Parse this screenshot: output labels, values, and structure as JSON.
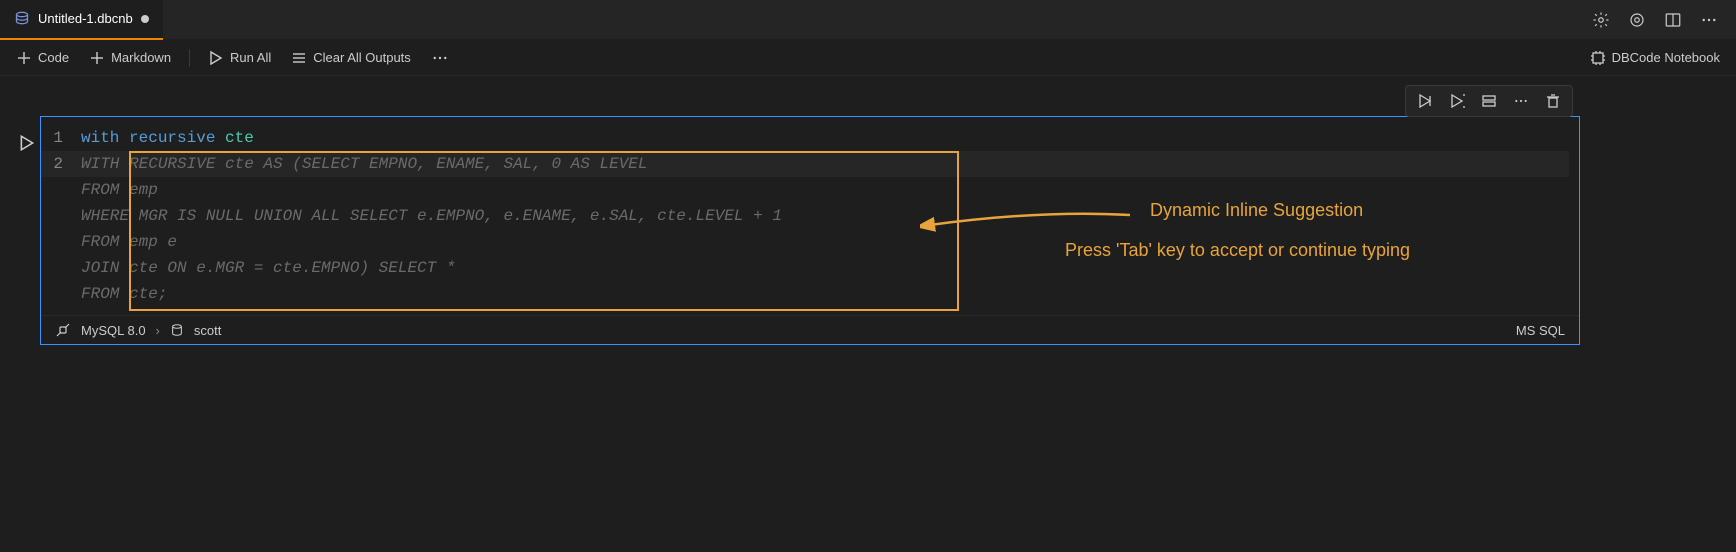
{
  "tab": {
    "title": "Untitled-1.dbcnb",
    "icon": "database-stack-icon"
  },
  "toolbar": {
    "code": "Code",
    "markdown": "Markdown",
    "run_all": "Run All",
    "clear_outputs": "Clear All Outputs",
    "notebook_label": "DBCode Notebook"
  },
  "code": {
    "line1_kw1": "with",
    "line1_kw2": "recursive",
    "line1_id": "cte",
    "ghost": {
      "l2": "WITH RECURSIVE cte AS (SELECT EMPNO, ENAME, SAL, 0 AS LEVEL",
      "l3": "FROM emp",
      "l4": "WHERE MGR IS NULL UNION ALL SELECT e.EMPNO, e.ENAME, e.SAL, cte.LEVEL + 1",
      "l5": "FROM emp e",
      "l6": "JOIN cte ON e.MGR = cte.EMPNO) SELECT *",
      "l7": "FROM cte;"
    }
  },
  "status": {
    "connection": "MySQL 8.0",
    "schema": "scott",
    "lang": "MS SQL"
  },
  "annotation": {
    "title": "Dynamic Inline Suggestion",
    "subtitle": "Press 'Tab' key to accept or continue typing"
  },
  "line_numbers": {
    "l1": "1",
    "l2": "2"
  }
}
